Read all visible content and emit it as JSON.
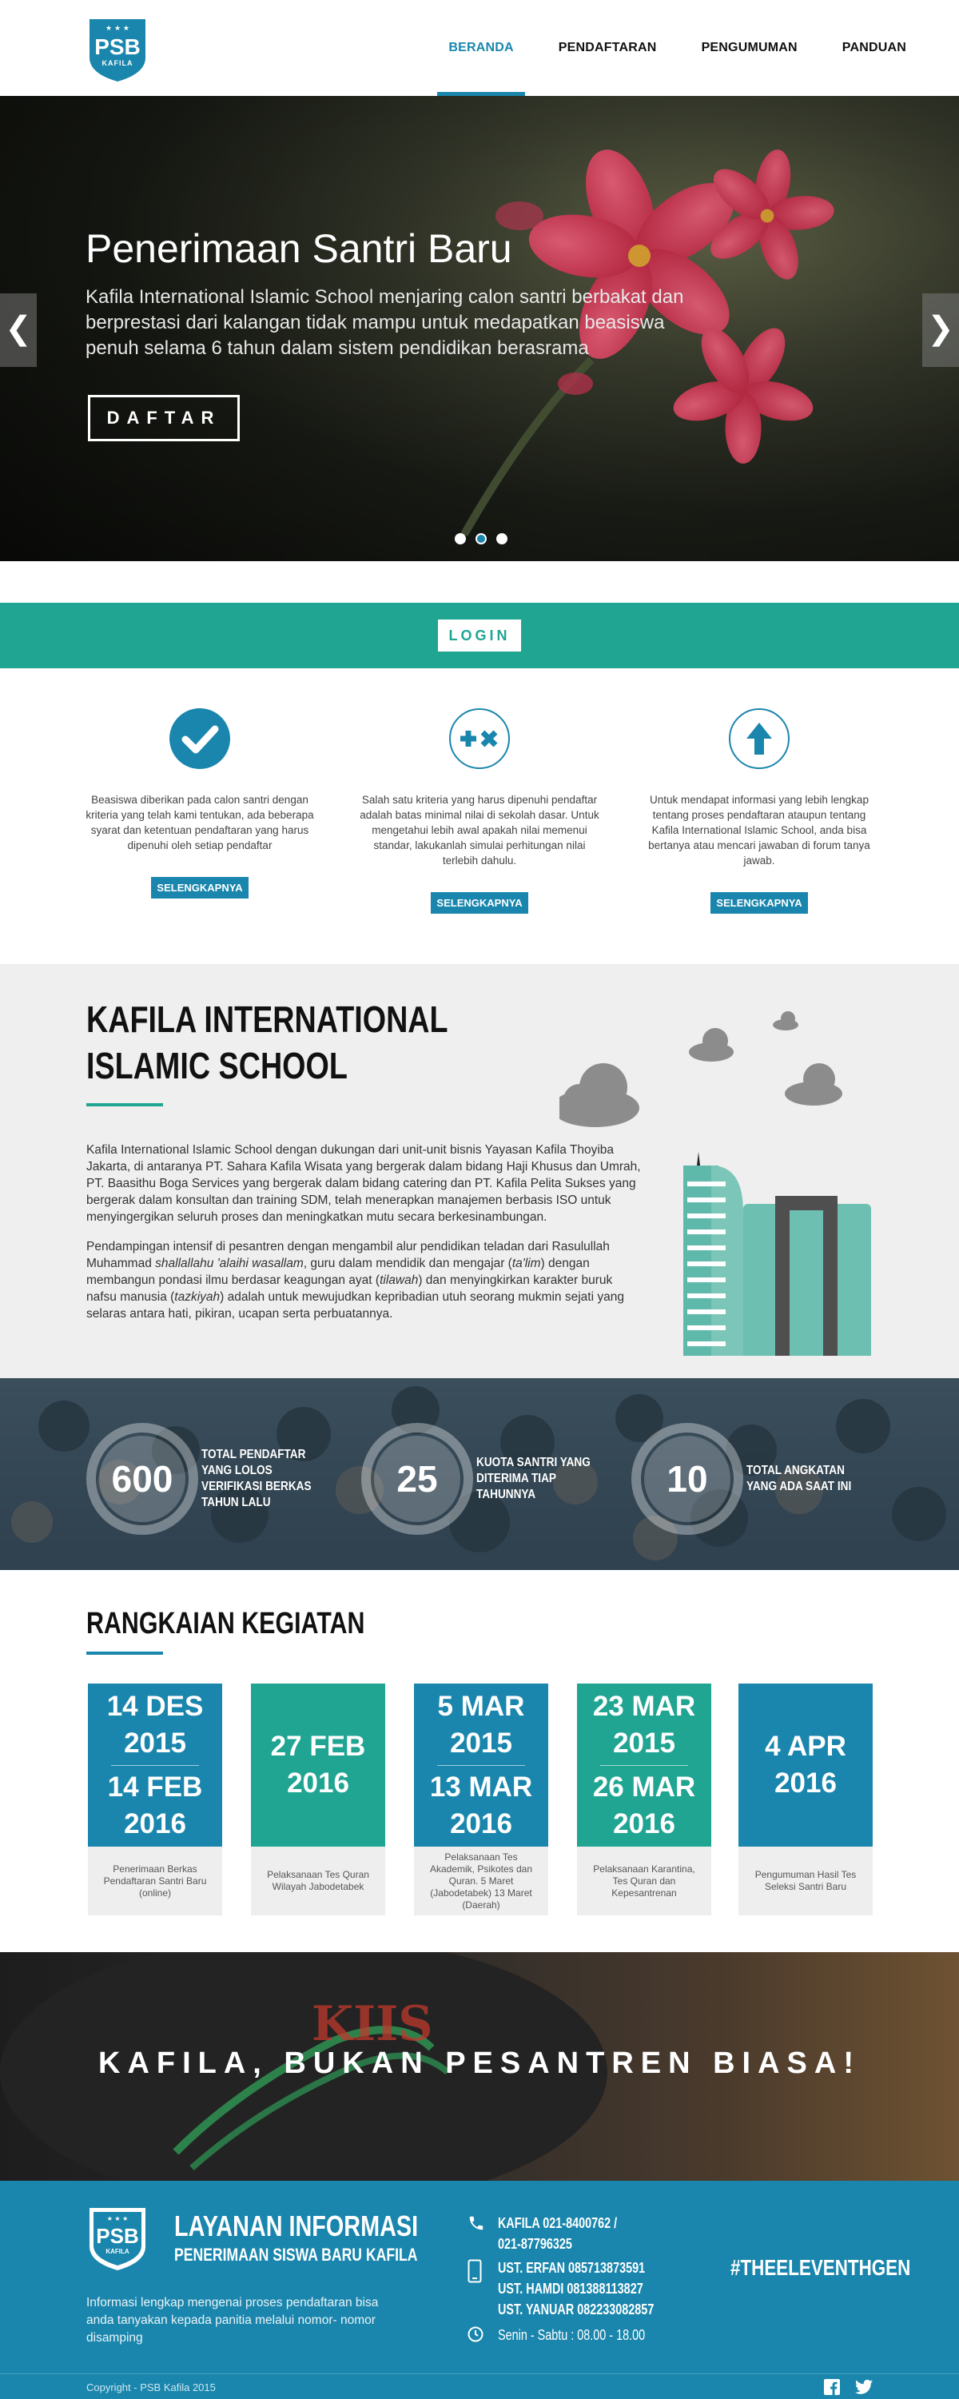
{
  "brand": {
    "logo_text": "PSB",
    "logo_sub": "KAFILA",
    "primary": "#1a86ad",
    "accent": "#1fa592"
  },
  "nav": {
    "items": [
      {
        "label": "BERANDA",
        "active": true
      },
      {
        "label": "PENDAFTARAN"
      },
      {
        "label": "PENGUMUMAN"
      },
      {
        "label": "PANDUAN"
      }
    ]
  },
  "hero": {
    "title": "Penerimaan Santri Baru",
    "text": "Kafila International Islamic School menjaring calon santri berbakat dan berprestasi dari kalangan tidak mampu untuk medapatkan beasiswa penuh selama 6 tahun dalam sistem pendidikan berasrama",
    "button": "DAFTAR",
    "prev": "❮",
    "next": "❯",
    "active_slide": 2,
    "slides": 3
  },
  "login": {
    "label": "LOGIN"
  },
  "features": [
    {
      "icon": "check-icon",
      "text": "Beasiswa diberikan pada calon santri dengan kriteria yang telah kami tentukan, ada beberapa syarat dan ketentuan pendaftaran yang harus dipenuhi oleh setiap pendaftar",
      "button": "SELENGKAPNYA"
    },
    {
      "icon": "plus-times-icon",
      "text": "Salah satu kriteria yang harus dipenuhi pendaftar adalah batas minimal nilai di sekolah dasar. Untuk mengetahui lebih awal apakah nilai memenui standar, lakukanlah simulai perhitungan nilai terlebih dahulu.",
      "button": "SELENGKAPNYA"
    },
    {
      "icon": "arrow-up-icon",
      "text": "Untuk mendapat informasi yang lebih lengkap tentang proses pendaftaran ataupun tentang Kafila International Islamic School, anda bisa bertanya atau mencari jawaban di forum tanya jawab.",
      "button": "SELENGKAPNYA"
    }
  ],
  "about": {
    "title_line1": "KAFILA INTERNATIONAL",
    "title_line2": "ISLAMIC SCHOOL",
    "para1": "Kafila International Islamic School dengan dukungan dari unit-unit bisnis Yayasan Kafila Thoyiba Jakarta, di antaranya PT. Sahara Kafila Wisata yang bergerak dalam bidang Haji Khusus dan Umrah, PT. Baasithu Boga Services yang bergerak dalam bidang catering dan PT. Kafila Pelita Sukses yang bergerak dalam konsultan dan training SDM, telah menerapkan manajemen berbasis ISO untuk menyingergikan seluruh proses dan meningkatkan mutu secara berkesinambungan.",
    "para2_a": "Pendampingan intensif di pesantren dengan mengambil alur pendidikan teladan dari Rasulullah Muhammad ",
    "para2_b": "shallallahu 'alaihi wasallam",
    "para2_c": ", guru dalam mendidik dan mengajar (",
    "para2_d": "ta'lim",
    "para2_e": ") dengan membangun pondasi ilmu berdasar keagungan ayat (",
    "para2_f": "tilawah",
    "para2_g": ") dan menyingkirkan karakter buruk nafsu manusia (",
    "para2_h": "tazkiyah",
    "para2_i": ") adalah untuk mewujudkan kepribadian utuh seorang mukmin sejati yang selaras antara hati, pikiran, ucapan serta perbuatannya."
  },
  "stats": [
    {
      "value": "600",
      "label": "TOTAL PENDAFTAR YANG LOLOS VERIFIKASI BERKAS TAHUN LALU"
    },
    {
      "value": "25",
      "label": "KUOTA SANTRI YANG DITERIMA TIAP TAHUNNYA"
    },
    {
      "value": "10",
      "label": "TOTAL ANGKATAN YANG ADA SAAT INI"
    }
  ],
  "events": {
    "title": "RANGKAIAN KEGIATAN",
    "items": [
      {
        "date_a": "14 DES 2015",
        "date_b": "14 FEB 2016",
        "desc": "Penerimaan Berkas Pendaftaran Santri Baru (online)",
        "color": "blue"
      },
      {
        "date_a": "27 FEB 2016",
        "date_b": "",
        "desc": "Pelaksanaan Tes Quran Wilayah Jabodetabek",
        "color": "green"
      },
      {
        "date_a": "5 MAR 2015",
        "date_b": "13 MAR 2016",
        "desc": "Pelaksanaan Tes Akademik, Psikotes dan Quran. 5 Maret (Jabodetabek) 13 Maret (Daerah)",
        "color": "blue"
      },
      {
        "date_a": "23 MAR 2015",
        "date_b": "26 MAR 2016",
        "desc": "Pelaksanaan Karantina, Tes Quran dan Kepesantrenan",
        "color": "green"
      },
      {
        "date_a": "4 APR 2016",
        "date_b": "",
        "desc": "Pengumuman Hasil Tes Seleksi Santri Baru",
        "color": "blue"
      }
    ]
  },
  "banner": {
    "slogan": "KAFILA, BUKAN PESANTREN BIASA!"
  },
  "footer": {
    "title": "LAYANAN INFORMASI",
    "subtitle": "PENERIMAAN SISWA BARU KAFILA",
    "text": "Informasi lengkap mengenai proses pendaftaran bisa anda tanyakan kepada panitia melalui nomor- nomor disamping",
    "phone_1": "KAFILA 021-8400762 /",
    "phone_2": "021-87796325",
    "mobile_1": "UST. ERFAN 085713873591",
    "mobile_2": "UST. HAMDI 081388113827",
    "mobile_3": "UST. YANUAR 082233082857",
    "hours": "Senin - Sabtu : 08.00 - 18.00",
    "hashtag": "#THEELEVENTHGEN",
    "copyright": "Copyright - PSB Kafila 2015"
  }
}
